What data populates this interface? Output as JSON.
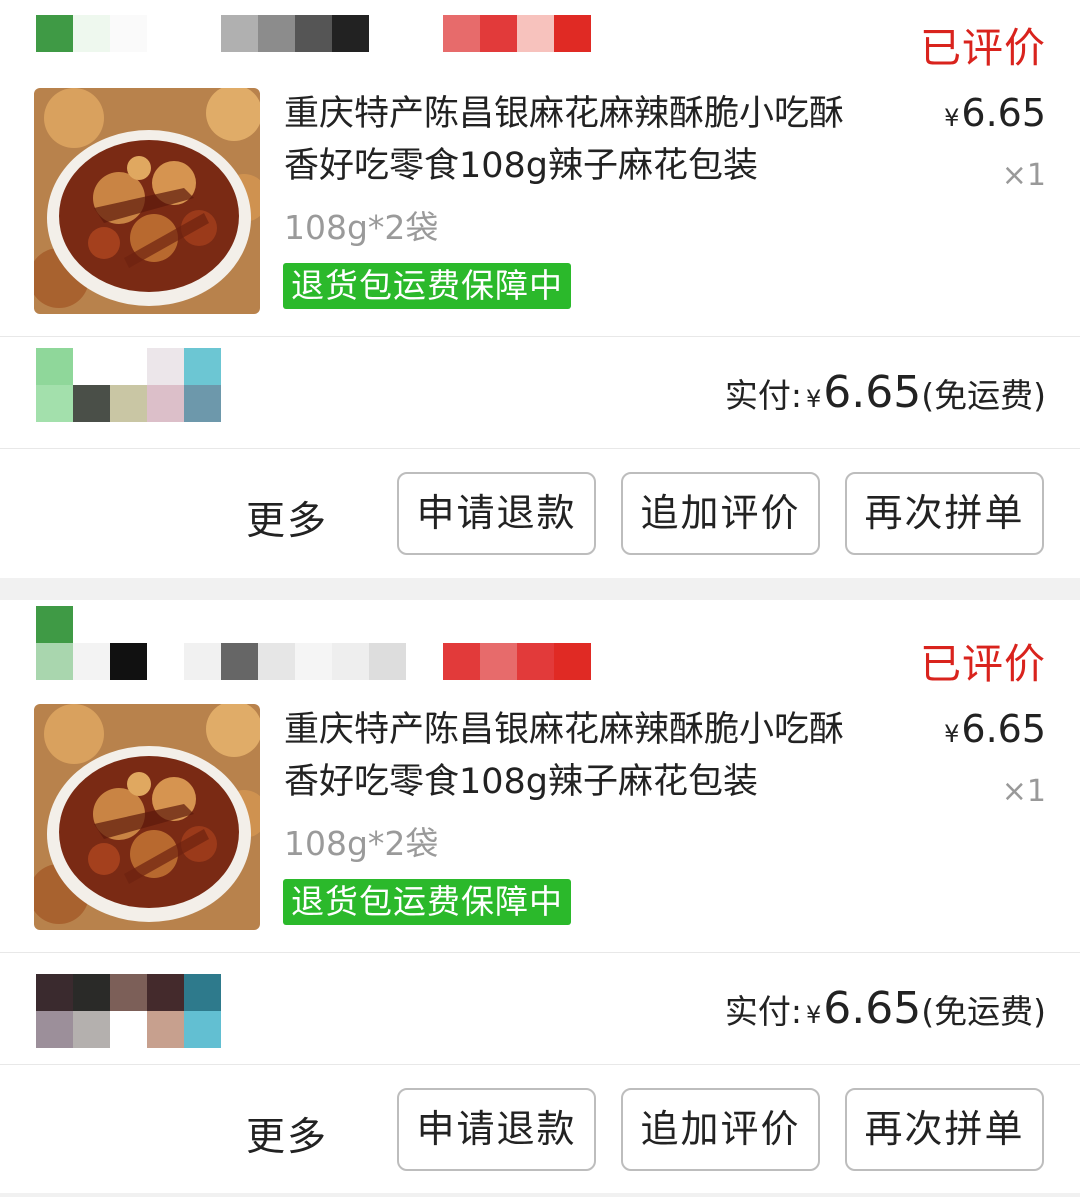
{
  "orders": [
    {
      "status": "已评价",
      "title_line1": "重庆特产陈昌银麻花麻辣酥脆小吃酥",
      "title_line2": "香好吃零食108g辣子麻花包装",
      "currency": "¥",
      "unit_price": "6.65",
      "quantity": "×1",
      "spec": "108g*2袋",
      "guarantee": "退货包运费保障中",
      "paid_label": "实付:",
      "paid_amount": "6.65",
      "shipping_note": "(免运费)",
      "more_label": "更多",
      "buttons": [
        "申请退款",
        "追加评价",
        "再次拼单"
      ]
    },
    {
      "status": "已评价",
      "title_line1": "重庆特产陈昌银麻花麻辣酥脆小吃酥",
      "title_line2": "香好吃零食108g辣子麻花包装",
      "currency": "¥",
      "unit_price": "6.65",
      "quantity": "×1",
      "spec": "108g*2袋",
      "guarantee": "退货包运费保障中",
      "paid_label": "实付:",
      "paid_amount": "6.65",
      "shipping_note": "(免运费)",
      "more_label": "更多",
      "buttons": [
        "申请退款",
        "追加评价",
        "再次拼单"
      ]
    }
  ],
  "colors": {
    "status_red": "#d9231d",
    "guarantee_green": "#2bb92b",
    "button_border": "#bdbdbd"
  }
}
